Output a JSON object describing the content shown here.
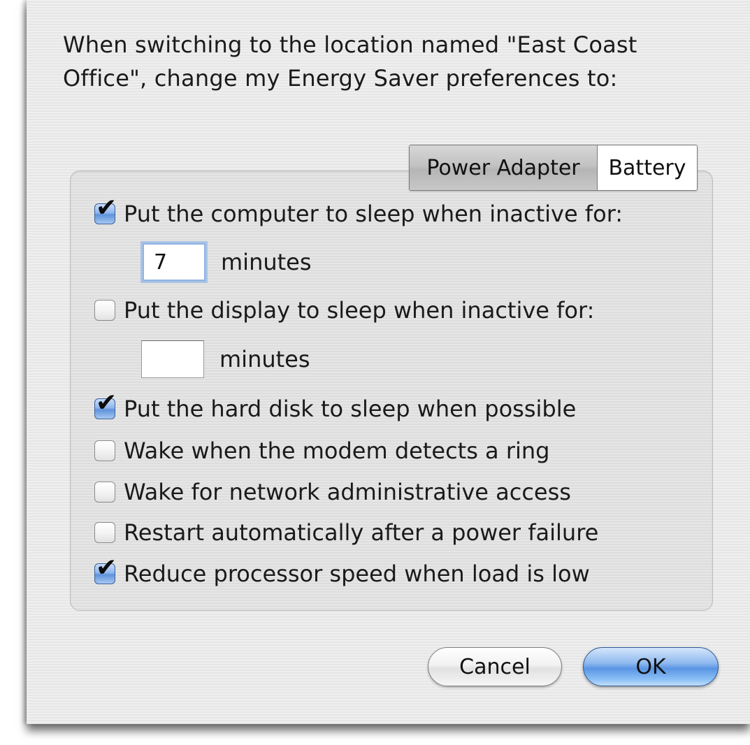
{
  "dialog": {
    "intro_text": "When switching to the location named \"East Coast Office\", change my Energy Saver preferences to:"
  },
  "tabs": [
    {
      "label": "Power Adapter",
      "selected": true
    },
    {
      "label": "Battery",
      "selected": false
    }
  ],
  "options": {
    "computer_sleep": {
      "label": "Put the computer to sleep when inactive for:",
      "checked": true
    },
    "computer_sleep_minutes": {
      "value": "7",
      "unit": "minutes"
    },
    "display_sleep": {
      "label": "Put the display to sleep when inactive for:",
      "checked": false
    },
    "display_sleep_minutes": {
      "value": "",
      "unit": "minutes"
    },
    "hard_disk_sleep": {
      "label": "Put the hard disk to sleep when possible",
      "checked": true
    },
    "wake_modem": {
      "label": "Wake when the modem detects a ring",
      "checked": false
    },
    "wake_network": {
      "label": "Wake for network administrative access",
      "checked": false
    },
    "restart_power_failure": {
      "label": "Restart automatically after a power failure",
      "checked": false
    },
    "reduce_processor": {
      "label": "Reduce processor speed when load is low",
      "checked": true
    }
  },
  "buttons": {
    "cancel_label": "Cancel",
    "ok_label": "OK"
  },
  "colors": {
    "accent": "#5a95e4",
    "sheet_background": "#ececec"
  }
}
